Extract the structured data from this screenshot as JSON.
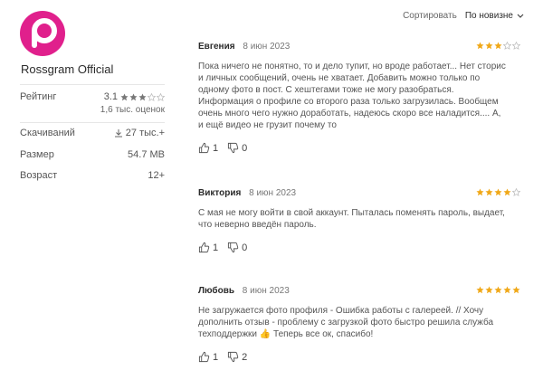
{
  "app": {
    "name": "Rossgram Official",
    "icon_color": "#e0208c"
  },
  "sort": {
    "label": "Сортировать",
    "value": "По новизне"
  },
  "info": {
    "rating_label": "Рейтинг",
    "rating_value": "3.1",
    "rating_stars": 3,
    "rating_count": "1,6 тыс. оценок",
    "downloads_label": "Скачиваний",
    "downloads_value": "27 тыс.+",
    "size_label": "Размер",
    "size_value": "54.7 MB",
    "age_label": "Возраст",
    "age_value": "12+"
  },
  "colors": {
    "star_filled": "#f0a818",
    "star_empty": "#bbbbbb"
  },
  "reviews": [
    {
      "author": "Евгения",
      "date": "8 июн 2023",
      "stars": 3,
      "text": "Пока ничего не понятно, то и дело тупит, но вроде работает... Нет сторис и личных сообщений, очень не хватает. Добавить можно только по одному фото в пост. С хештегами тоже не могу разобраться. Информация о профиле со второго раза только загрузилась. Вообщем очень много чего нужно доработать, надеюсь скоро все наладится.... А, и ещё видео не грузит почему то",
      "likes": "1",
      "dislikes": "0"
    },
    {
      "author": "Виктория",
      "date": "8 июн 2023",
      "stars": 4,
      "text": "С мая не могу войти в свой аккаунт. Пыталась поменять пароль, выдает, что неверно введён пароль.",
      "likes": "1",
      "dislikes": "0"
    },
    {
      "author": "Любовь",
      "date": "8 июн 2023",
      "stars": 5,
      "text": "Не загружается фото профиля - Ошибка работы с галереей. // Хочу дополнить отзыв - проблему с загрузкой фото быстро решила служба техподдержки 👍 Теперь все ок, спасибо!",
      "likes": "1",
      "dislikes": "2"
    }
  ]
}
